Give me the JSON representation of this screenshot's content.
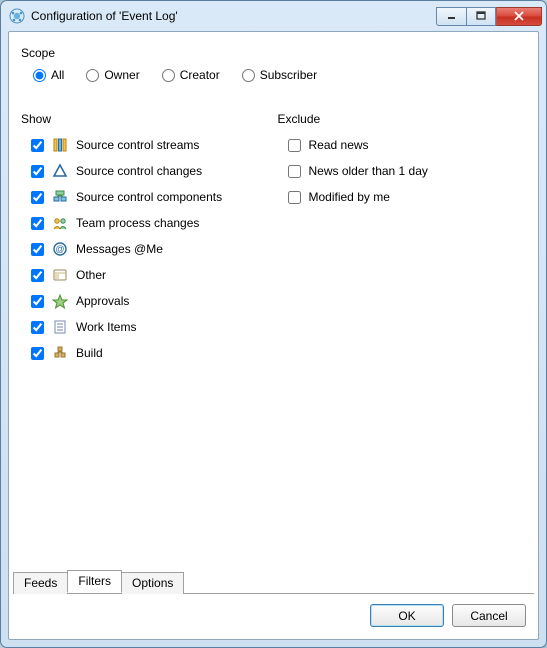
{
  "window": {
    "title": "Configuration of 'Event Log'",
    "buttons": {
      "minimize": "–",
      "maximize": "▭",
      "close": "✕"
    }
  },
  "scope": {
    "label": "Scope",
    "options": [
      "All",
      "Owner",
      "Creator",
      "Subscriber"
    ],
    "selected": "All"
  },
  "show": {
    "label": "Show",
    "items": [
      {
        "label": "Source control streams",
        "checked": true,
        "icon": "streams"
      },
      {
        "label": "Source control changes",
        "checked": true,
        "icon": "changes"
      },
      {
        "label": "Source control components",
        "checked": true,
        "icon": "components"
      },
      {
        "label": "Team process changes",
        "checked": true,
        "icon": "team"
      },
      {
        "label": "Messages @Me",
        "checked": true,
        "icon": "message"
      },
      {
        "label": "Other",
        "checked": true,
        "icon": "other"
      },
      {
        "label": "Approvals",
        "checked": true,
        "icon": "approvals"
      },
      {
        "label": "Work Items",
        "checked": true,
        "icon": "workitems"
      },
      {
        "label": "Build",
        "checked": true,
        "icon": "build"
      }
    ]
  },
  "exclude": {
    "label": "Exclude",
    "items": [
      {
        "label": "Read news",
        "checked": false
      },
      {
        "label": "News older than 1 day",
        "checked": false
      },
      {
        "label": "Modified by me",
        "checked": false
      }
    ]
  },
  "tabs": {
    "items": [
      "Feeds",
      "Filters",
      "Options"
    ],
    "active": "Filters"
  },
  "buttons": {
    "ok": "OK",
    "cancel": "Cancel"
  }
}
